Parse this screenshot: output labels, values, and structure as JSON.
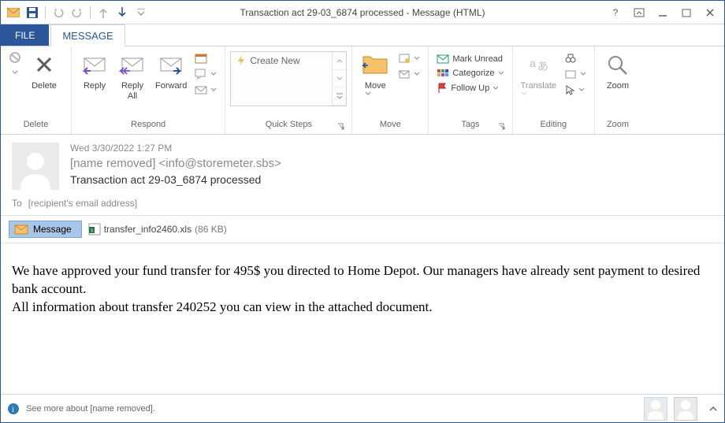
{
  "window": {
    "title": "Transaction act 29-03_6874  processed - Message (HTML)"
  },
  "tabs": {
    "file": "FILE",
    "message": "MESSAGE"
  },
  "ribbon": {
    "delete": {
      "delete": "Delete",
      "group": "Delete"
    },
    "respond": {
      "reply": "Reply",
      "replyall": "Reply\nAll",
      "forward": "Forward",
      "group": "Respond"
    },
    "quicksteps": {
      "createnew": "Create New",
      "group": "Quick Steps"
    },
    "move": {
      "move": "Move",
      "group": "Move"
    },
    "tags": {
      "markunread": "Mark Unread",
      "categorize": "Categorize",
      "followup": "Follow Up",
      "group": "Tags"
    },
    "editing": {
      "translate": "Translate",
      "group": "Editing"
    },
    "zoom": {
      "zoom": "Zoom",
      "group": "Zoom"
    }
  },
  "message": {
    "date": "Wed 3/30/2022 1:27 PM",
    "from": "[name removed] <info@storemeter.sbs>",
    "subject": "Transaction act 29-03_6874  processed",
    "to_label": "To",
    "to_value": "[recipient's email address]",
    "tab_message": "Message",
    "attachment_name": "transfer_info2460.xls",
    "attachment_size": "(86 KB)",
    "body_p1": " We have approved your fund transfer for 495$ you directed to Home Depot. Our managers have already sent payment to desired bank account.",
    "body_p2": "All information about transfer 240252 you can view in the attached document."
  },
  "status": {
    "text": "See more about [name removed]."
  }
}
